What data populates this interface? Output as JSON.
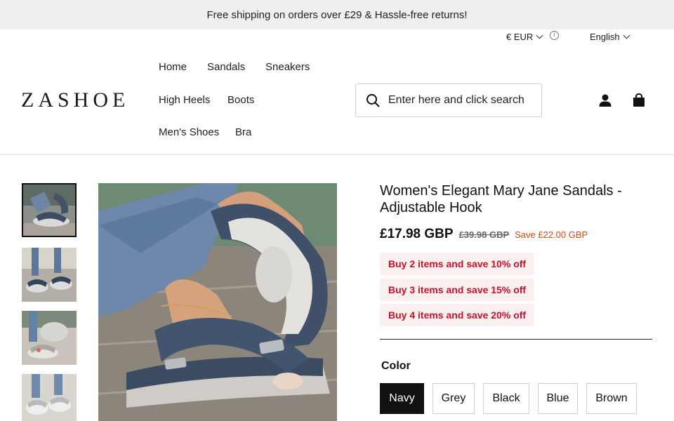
{
  "announcement": "Free shipping on orders over £29 & Hassle-free returns!",
  "topbar": {
    "currency": "€ EUR",
    "language": "English",
    "info_icon": "info-icon"
  },
  "brand": {
    "logo": "ZASHOE"
  },
  "nav": {
    "items": [
      "Home",
      "Sandals",
      "Sneakers",
      "High Heels",
      "Boots",
      "Men's Shoes",
      "Bra"
    ]
  },
  "search": {
    "placeholder": "Enter here and click search",
    "icon": "search-icon"
  },
  "header_icons": {
    "account": "user-icon",
    "cart": "shopping-bag-icon"
  },
  "product": {
    "title": "Women's Elegant Mary Jane Sandals - Adjustable Hook",
    "price": "£17.98 GBP",
    "compare_price": "£39.98 GBP",
    "savings": "Save £22.00 GBP",
    "promotions": [
      "Buy 2 items and save 10% off",
      "Buy 3 items and save 15% off",
      "Buy 4 items and save 20% off"
    ],
    "color_label": "Color",
    "colors": [
      "Navy",
      "Grey",
      "Black",
      "Blue",
      "Brown"
    ],
    "selected_color": "Navy"
  },
  "colors": {
    "accent_red": "#c8102e",
    "save_orange": "#d9480f",
    "announcement_bg": "#efefef",
    "selected_swatch": "#111111"
  }
}
